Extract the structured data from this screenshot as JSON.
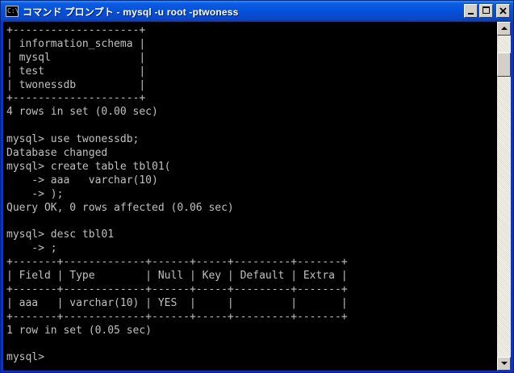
{
  "window": {
    "title": "コマンド プロンプト - mysql -u root -ptwoness",
    "icon_label": "C:\\",
    "buttons": {
      "minimize": "minimize-icon",
      "maximize": "maximize-icon",
      "close": "close-icon"
    },
    "colors": {
      "titlebar": "#0550d8",
      "console_bg": "#000000",
      "console_fg": "#c0c0c0"
    }
  },
  "console": {
    "lines": [
      "+--------------------+",
      "| information_schema |",
      "| mysql              |",
      "| test               |",
      "| twonessdb          |",
      "+--------------------+",
      "4 rows in set (0.00 sec)",
      "",
      "mysql> use twonessdb;",
      "Database changed",
      "mysql> create table tbl01(",
      "    -> aaa   varchar(10)",
      "    -> );",
      "Query OK, 0 rows affected (0.06 sec)",
      "",
      "mysql> desc tbl01",
      "    -> ;",
      "+-------+-------------+------+-----+---------+-------+",
      "| Field | Type        | Null | Key | Default | Extra |",
      "+-------+-------------+------+-----+---------+-------+",
      "| aaa   | varchar(10) | YES  |     |         |       |",
      "+-------+-------------+------+-----+---------+-------+",
      "1 row in set (0.05 sec)",
      "",
      "mysql>"
    ]
  }
}
